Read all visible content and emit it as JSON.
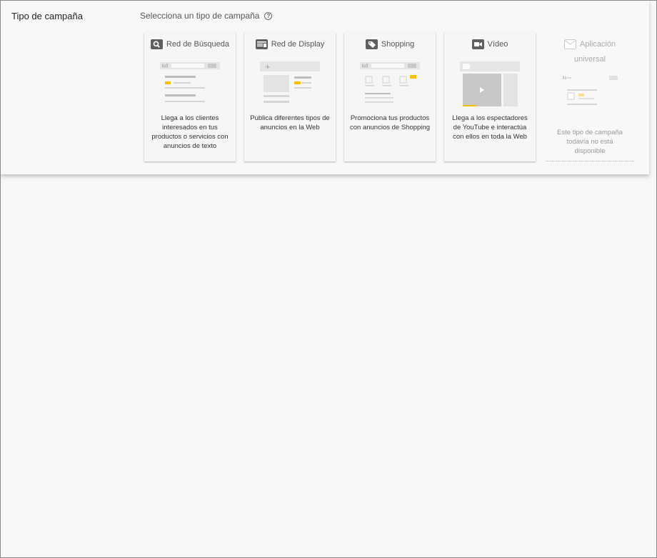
{
  "section": {
    "label": "Tipo de campaña",
    "heading": "Selecciona un tipo de campaña",
    "help_icon": "help-circle-icon"
  },
  "cards": [
    {
      "title": "Red de Búsqueda",
      "icon": "search-icon",
      "description": "Llega a los clientes interesados en tus productos o servicios con anuncios de texto"
    },
    {
      "title": "Red de Display",
      "icon": "display-icon",
      "description": "Publica diferentes tipos de anuncios en la Web"
    },
    {
      "title": "Shopping",
      "icon": "tag-icon",
      "description": "Promociona tus productos con anuncios de Shopping"
    },
    {
      "title": "Vídeo",
      "icon": "video-camera-icon",
      "description": "Llega a los espectadores de YouTube e interactúa con ellos en toda la Web"
    },
    {
      "title_line1": "Aplicación",
      "title_line2": "universal",
      "icon": "app-icon",
      "description": "Este tipo de campaña todavía no está disponible"
    }
  ],
  "colors": {
    "accent": "#f4c20d",
    "icon_dark": "#5f5f5f",
    "placeholder": "#d9d9d9"
  }
}
